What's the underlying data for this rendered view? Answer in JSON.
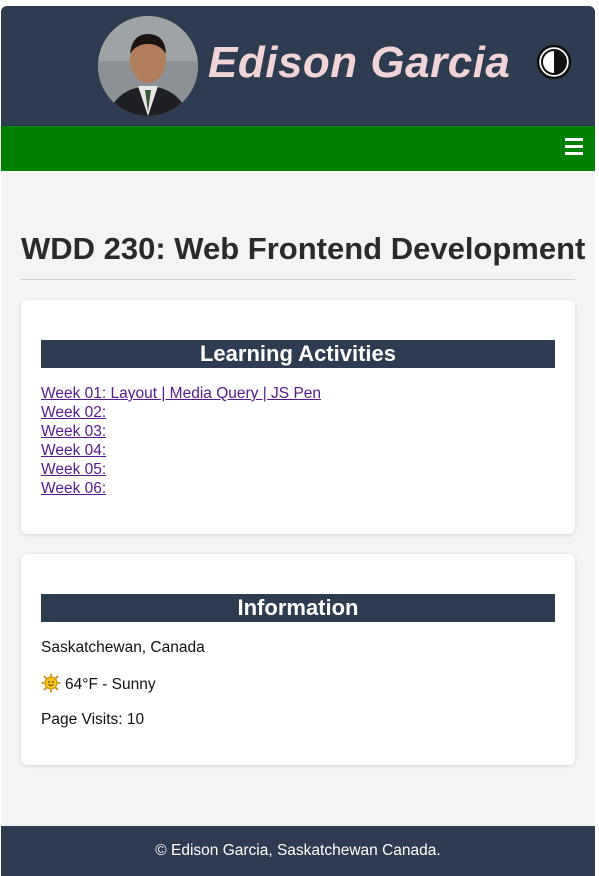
{
  "header": {
    "site_name": "Edison Garcia",
    "theme_toggle_icon": "contrast-icon",
    "avatar_icon": "profile-photo"
  },
  "nav": {
    "menu_icon": "hamburger-icon",
    "bar_color": "#008000"
  },
  "main": {
    "title": "WDD 230: Web Frontend Development",
    "learning": {
      "heading": "Learning Activities",
      "links": [
        "Week 01: Layout | Media Query | JS Pen",
        "Week 02:",
        "Week 03:",
        "Week 04:",
        "Week 05:",
        "Week 06:"
      ]
    },
    "information": {
      "heading": "Information",
      "location": "Saskatchewan, Canada",
      "weather_icon": "sun-icon",
      "weather": "64°F - Sunny",
      "visits": "Page Visits: 10"
    }
  },
  "footer": {
    "text": "© Edison Garcia, Saskatchewan Canada."
  },
  "colors": {
    "header_bg": "#2d3c50",
    "site_name": "#f2d4d8",
    "link": "#551a8b",
    "page_bg": "#f4f4f4"
  }
}
